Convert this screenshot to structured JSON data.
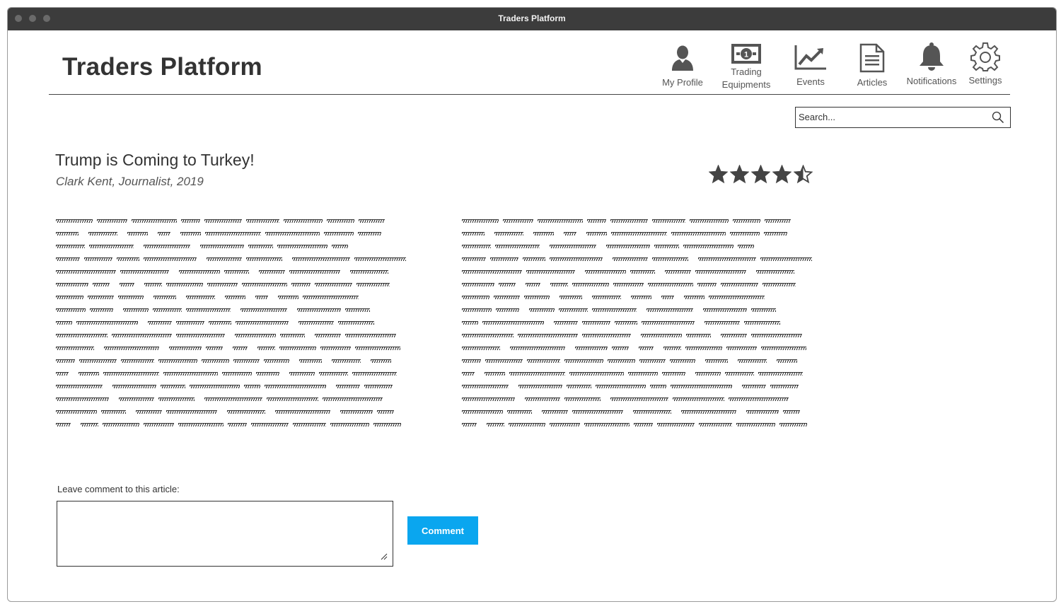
{
  "window": {
    "title": "Traders Platform"
  },
  "header": {
    "app_title": "Traders Platform",
    "nav": [
      {
        "label": "My Profile",
        "icon": "user-icon"
      },
      {
        "label": "Trading\nEquipments",
        "icon": "banknote-icon"
      },
      {
        "label": "Events",
        "icon": "line-chart-icon"
      },
      {
        "label": "Articles",
        "icon": "document-icon"
      },
      {
        "label": "Notifications",
        "icon": "bell-icon"
      },
      {
        "label": "Settings",
        "icon": "gear-icon"
      }
    ]
  },
  "search": {
    "placeholder": "Search..."
  },
  "article": {
    "title": "Trump is Coming to Turkey!",
    "byline": "Clark Kent, Journalist, 2019",
    "rating": 4.5,
    "rating_max": 5
  },
  "comment": {
    "label": "Leave comment to this article:",
    "value": "",
    "button_label": "Comment"
  },
  "colors": {
    "accent": "#0aa6ef",
    "titlebar": "#3c3c3c",
    "icon": "#555555"
  }
}
